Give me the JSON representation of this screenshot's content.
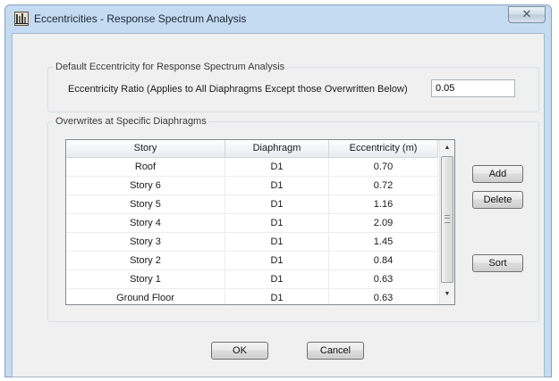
{
  "window": {
    "title": "Eccentricities - Response Spectrum Analysis",
    "icon": "etabs-app-icon",
    "close_glyph": "✕"
  },
  "default_group": {
    "legend": "Default Eccentricity for Response Spectrum Analysis",
    "ratio_label": "Eccentricity Ratio (Applies to All Diaphragms Except those Overwritten Below)",
    "ratio_value": "0.05"
  },
  "overwrites_group": {
    "legend": "Overwrites at Specific Diaphragms",
    "columns": [
      "Story",
      "Diaphragm",
      "Eccentricity (m)"
    ],
    "rows": [
      {
        "story": "Roof",
        "diaphragm": "D1",
        "eccentricity": "0.70"
      },
      {
        "story": "Story 6",
        "diaphragm": "D1",
        "eccentricity": "0.72"
      },
      {
        "story": "Story 5",
        "diaphragm": "D1",
        "eccentricity": "1.16"
      },
      {
        "story": "Story 4",
        "diaphragm": "D1",
        "eccentricity": "2.09"
      },
      {
        "story": "Story 3",
        "diaphragm": "D1",
        "eccentricity": "1.45"
      },
      {
        "story": "Story 2",
        "diaphragm": "D1",
        "eccentricity": "0.84"
      },
      {
        "story": "Story 1",
        "diaphragm": "D1",
        "eccentricity": "0.63"
      },
      {
        "story": "Ground Floor",
        "diaphragm": "D1",
        "eccentricity": "0.63"
      }
    ],
    "add_label": "Add",
    "delete_label": "Delete",
    "sort_label": "Sort"
  },
  "footer": {
    "ok_label": "OK",
    "cancel_label": "Cancel"
  },
  "colors": {
    "window_frame": "#c4dbf1",
    "dialog_bg": "#f0f0f0"
  }
}
